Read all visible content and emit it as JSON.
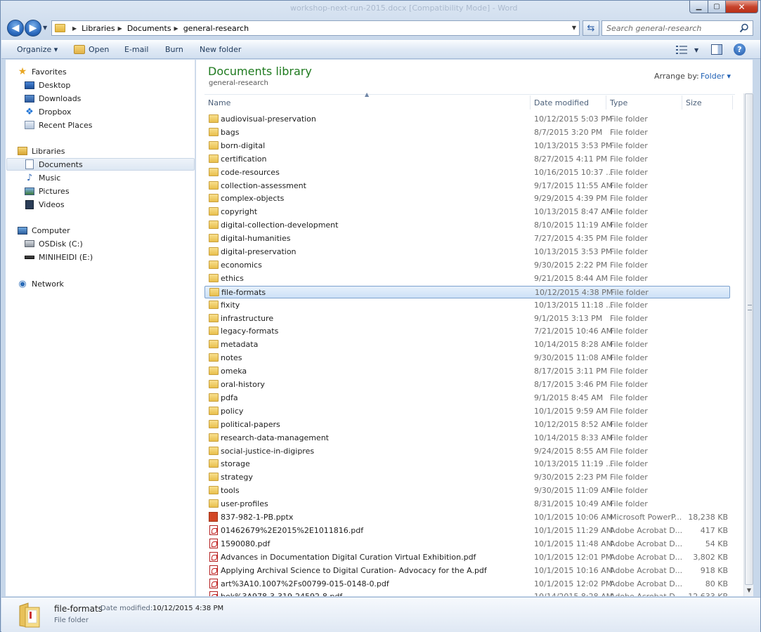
{
  "caption_ghost": "workshop-next-run-2015.docx [Compatibility Mode] - Word",
  "address": {
    "breadcrumbs": [
      "Libraries",
      "Documents",
      "general-research"
    ]
  },
  "search": {
    "placeholder": "Search general-research"
  },
  "toolbar": {
    "organize": "Organize ▾",
    "open": "Open",
    "email": "E-mail",
    "burn": "Burn",
    "new_folder": "New folder"
  },
  "navpane": {
    "favorites": "Favorites",
    "fav_items": [
      "Desktop",
      "Downloads",
      "Dropbox",
      "Recent Places"
    ],
    "libraries": "Libraries",
    "lib_items": [
      "Documents",
      "Music",
      "Pictures",
      "Videos"
    ],
    "computer": "Computer",
    "comp_items": [
      "OSDisk (C:)",
      "MINIHEIDI (E:)"
    ],
    "network": "Network"
  },
  "content": {
    "title": "Documents library",
    "subtitle": "general-research",
    "arrange_label": "Arrange by:",
    "arrange_value": "Folder ▾",
    "columns": {
      "name": "Name",
      "date": "Date modified",
      "type": "Type",
      "size": "Size"
    }
  },
  "files": [
    {
      "name": "audiovisual-preservation",
      "date": "10/12/2015 5:03 PM",
      "type": "File folder",
      "size": "",
      "kind": "folder"
    },
    {
      "name": "bags",
      "date": "8/7/2015 3:20 PM",
      "type": "File folder",
      "size": "",
      "kind": "folder"
    },
    {
      "name": "born-digital",
      "date": "10/13/2015 3:53 PM",
      "type": "File folder",
      "size": "",
      "kind": "folder"
    },
    {
      "name": "certification",
      "date": "8/27/2015 4:11 PM",
      "type": "File folder",
      "size": "",
      "kind": "folder"
    },
    {
      "name": "code-resources",
      "date": "10/16/2015 10:37 ...",
      "type": "File folder",
      "size": "",
      "kind": "folder"
    },
    {
      "name": "collection-assessment",
      "date": "9/17/2015 11:55 AM",
      "type": "File folder",
      "size": "",
      "kind": "folder"
    },
    {
      "name": "complex-objects",
      "date": "9/29/2015 4:39 PM",
      "type": "File folder",
      "size": "",
      "kind": "folder"
    },
    {
      "name": "copyright",
      "date": "10/13/2015 8:47 AM",
      "type": "File folder",
      "size": "",
      "kind": "folder"
    },
    {
      "name": "digital-collection-development",
      "date": "8/10/2015 11:19 AM",
      "type": "File folder",
      "size": "",
      "kind": "folder"
    },
    {
      "name": "digital-humanities",
      "date": "7/27/2015 4:35 PM",
      "type": "File folder",
      "size": "",
      "kind": "folder"
    },
    {
      "name": "digital-preservation",
      "date": "10/13/2015 3:53 PM",
      "type": "File folder",
      "size": "",
      "kind": "folder"
    },
    {
      "name": "economics",
      "date": "9/30/2015 2:22 PM",
      "type": "File folder",
      "size": "",
      "kind": "folder"
    },
    {
      "name": "ethics",
      "date": "9/21/2015 8:44 AM",
      "type": "File folder",
      "size": "",
      "kind": "folder"
    },
    {
      "name": "file-formats",
      "date": "10/12/2015 4:38 PM",
      "type": "File folder",
      "size": "",
      "kind": "folder",
      "selected": true
    },
    {
      "name": "fixity",
      "date": "10/13/2015 11:18 ...",
      "type": "File folder",
      "size": "",
      "kind": "folder"
    },
    {
      "name": "infrastructure",
      "date": "9/1/2015 3:13 PM",
      "type": "File folder",
      "size": "",
      "kind": "folder"
    },
    {
      "name": "legacy-formats",
      "date": "7/21/2015 10:46 AM",
      "type": "File folder",
      "size": "",
      "kind": "folder"
    },
    {
      "name": "metadata",
      "date": "10/14/2015 8:28 AM",
      "type": "File folder",
      "size": "",
      "kind": "folder"
    },
    {
      "name": "notes",
      "date": "9/30/2015 11:08 AM",
      "type": "File folder",
      "size": "",
      "kind": "folder"
    },
    {
      "name": "omeka",
      "date": "8/17/2015 3:11 PM",
      "type": "File folder",
      "size": "",
      "kind": "folder"
    },
    {
      "name": "oral-history",
      "date": "8/17/2015 3:46 PM",
      "type": "File folder",
      "size": "",
      "kind": "folder"
    },
    {
      "name": "pdfa",
      "date": "9/1/2015 8:45 AM",
      "type": "File folder",
      "size": "",
      "kind": "folder"
    },
    {
      "name": "policy",
      "date": "10/1/2015 9:59 AM",
      "type": "File folder",
      "size": "",
      "kind": "folder"
    },
    {
      "name": "political-papers",
      "date": "10/12/2015 8:52 AM",
      "type": "File folder",
      "size": "",
      "kind": "folder"
    },
    {
      "name": "research-data-management",
      "date": "10/14/2015 8:33 AM",
      "type": "File folder",
      "size": "",
      "kind": "folder"
    },
    {
      "name": "social-justice-in-digipres",
      "date": "9/24/2015 8:55 AM",
      "type": "File folder",
      "size": "",
      "kind": "folder"
    },
    {
      "name": "storage",
      "date": "10/13/2015 11:19 ...",
      "type": "File folder",
      "size": "",
      "kind": "folder"
    },
    {
      "name": "strategy",
      "date": "9/30/2015 2:23 PM",
      "type": "File folder",
      "size": "",
      "kind": "folder"
    },
    {
      "name": "tools",
      "date": "9/30/2015 11:09 AM",
      "type": "File folder",
      "size": "",
      "kind": "folder"
    },
    {
      "name": "user-profiles",
      "date": "8/31/2015 10:49 AM",
      "type": "File folder",
      "size": "",
      "kind": "folder"
    },
    {
      "name": "837-982-1-PB.pptx",
      "date": "10/1/2015 10:06 AM",
      "type": "Microsoft PowerP...",
      "size": "18,238 KB",
      "kind": "ppt"
    },
    {
      "name": "01462679%2E2015%2E1011816.pdf",
      "date": "10/1/2015 11:29 AM",
      "type": "Adobe Acrobat D...",
      "size": "417 KB",
      "kind": "pdf"
    },
    {
      "name": "1590080.pdf",
      "date": "10/1/2015 11:48 AM",
      "type": "Adobe Acrobat D...",
      "size": "54 KB",
      "kind": "pdf"
    },
    {
      "name": "Advances in Documentation Digital Curation Virtual Exhibition.pdf",
      "date": "10/1/2015 12:01 PM",
      "type": "Adobe Acrobat D...",
      "size": "3,802 KB",
      "kind": "pdf"
    },
    {
      "name": "Applying Archival Science to Digital Curation- Advocacy for the A.pdf",
      "date": "10/1/2015 10:16 AM",
      "type": "Adobe Acrobat D...",
      "size": "918 KB",
      "kind": "pdf"
    },
    {
      "name": "art%3A10.1007%2Fs00799-015-0148-0.pdf",
      "date": "10/1/2015 12:02 PM",
      "type": "Adobe Acrobat D...",
      "size": "80 KB",
      "kind": "pdf"
    },
    {
      "name": "bok%3A978-3-319-24592-8.pdf",
      "date": "10/14/2015 8:28 AM",
      "type": "Adobe Acrobat D...",
      "size": "12,633 KB",
      "kind": "pdf"
    }
  ],
  "details": {
    "name": "file-formats",
    "date_label": "Date modified:",
    "date": "10/12/2015 4:38 PM",
    "type": "File folder"
  }
}
